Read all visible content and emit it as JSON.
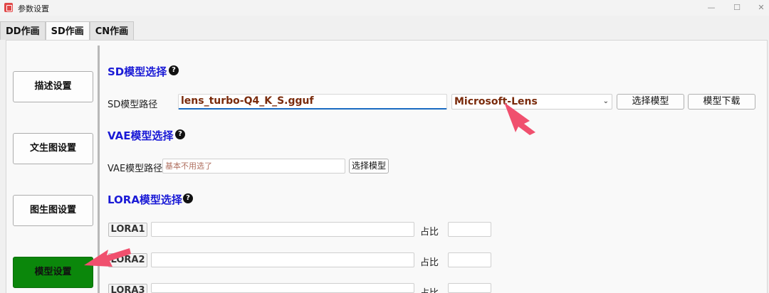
{
  "window": {
    "title": "参数设置",
    "min": "—",
    "max": "☐",
    "close": "✕"
  },
  "tabs": [
    {
      "label": "DD作画"
    },
    {
      "label": "SD作画"
    },
    {
      "label": "CN作画"
    }
  ],
  "sidebar": {
    "items": [
      {
        "label": "描述设置"
      },
      {
        "label": "文生图设置"
      },
      {
        "label": "图生图设置"
      },
      {
        "label": "模型设置"
      }
    ]
  },
  "sd": {
    "title": "SD模型选择",
    "path_label": "SD模型路径",
    "path_value": "lens_turbo-Q4_K_S.gguf",
    "model_selected": "Microsoft-Lens",
    "select_button": "选择模型",
    "download_button": "模型下载"
  },
  "vae": {
    "title": "VAE模型选择",
    "path_label": "VAE模型路径",
    "path_placeholder": "基本不用选了",
    "select_button": "选择模型"
  },
  "lora": {
    "title": "LORA模型选择",
    "ratio_label": "占比",
    "items": [
      {
        "label": "LORA1",
        "value": "",
        "ratio": ""
      },
      {
        "label": "LORA2",
        "value": "",
        "ratio": ""
      },
      {
        "label": "LORA3",
        "value": "",
        "ratio": ""
      }
    ]
  },
  "help_glyph": "?",
  "colors": {
    "section_title": "#1a1ad6",
    "active_sidebar": "#0b870b",
    "annotation_arrow": "#f0506e"
  }
}
